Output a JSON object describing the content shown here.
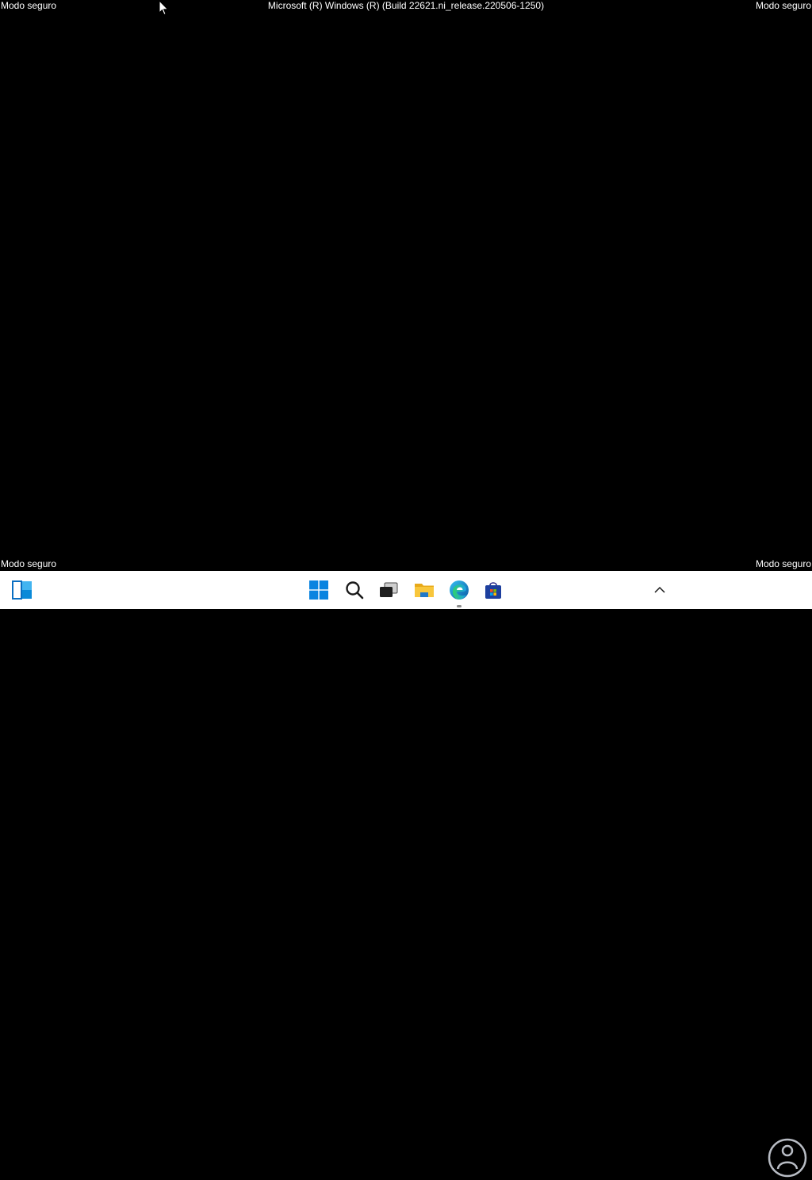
{
  "desktop": {
    "safe_mode_label_top_left": "Modo seguro",
    "safe_mode_label_top_right": "Modo seguro",
    "safe_mode_label_bottom_left": "Modo seguro",
    "safe_mode_label_bottom_right": "Modo seguro",
    "build_info": "Microsoft (R) Windows (R) (Build 22621.ni_release.220506-1250)",
    "background_color": "#000000"
  },
  "taskbar": {
    "background_color": "#ffffff",
    "items": [
      {
        "name": "widgets",
        "icon": "widgets-icon"
      },
      {
        "name": "start",
        "icon": "windows-logo-icon"
      },
      {
        "name": "search",
        "icon": "search-icon"
      },
      {
        "name": "task-view",
        "icon": "task-view-icon"
      },
      {
        "name": "file-explorer",
        "icon": "folder-icon"
      },
      {
        "name": "edge",
        "icon": "edge-browser-icon",
        "running": true
      },
      {
        "name": "store",
        "icon": "store-icon"
      }
    ],
    "tray": {
      "show_hidden_icon": "chevron-up-icon"
    }
  },
  "colors": {
    "accent_blue": "#0078d4",
    "folder_yellow": "#f8c63b"
  }
}
